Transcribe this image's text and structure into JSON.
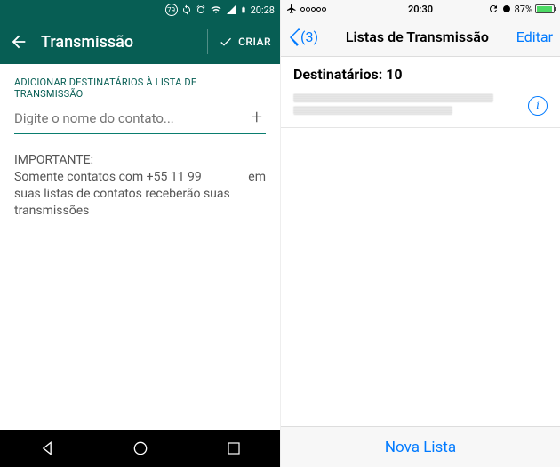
{
  "android": {
    "status": {
      "badge": "79",
      "time": "20:28"
    },
    "header": {
      "title": "Transmissão",
      "create": "CRIAR"
    },
    "body": {
      "label": "ADICIONAR DESTINATÁRIOS À LISTA DE TRANSMISSÃO",
      "placeholder": "Digite o nome do contato...",
      "important_title": "IMPORTANTE:",
      "important_line": "Somente contatos com +55 11 99",
      "important_em": "em",
      "important_rest": "suas listas de contatos receberão suas transmissões"
    }
  },
  "ios": {
    "status": {
      "time": "20:30",
      "battery": "87%"
    },
    "header": {
      "back_count": "(3)",
      "title": "Listas de Transmissão",
      "edit": "Editar"
    },
    "section": {
      "recipients_label": "Destinatários: 10"
    },
    "footer": {
      "new_list": "Nova Lista"
    }
  }
}
